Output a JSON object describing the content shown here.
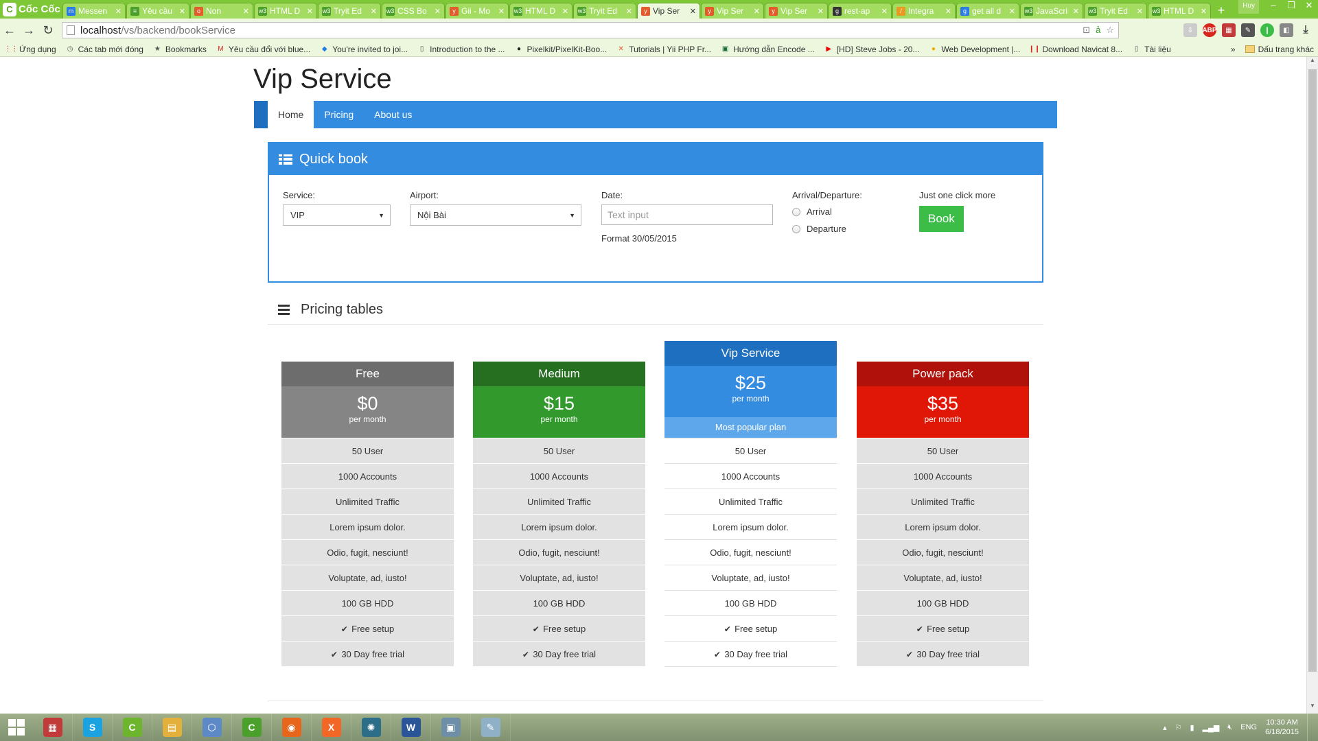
{
  "browser": {
    "brand": "Cốc Cốc",
    "tabs": [
      {
        "title": "Messen",
        "fav": "blue",
        "glyph": "m"
      },
      {
        "title": "Yêu cầu",
        "fav": "green",
        "glyph": "≡"
      },
      {
        "title": "Non",
        "fav": "red",
        "glyph": "o"
      },
      {
        "title": "HTML D",
        "fav": "green",
        "glyph": "w3"
      },
      {
        "title": "Tryit Ed",
        "fav": "green",
        "glyph": "w3"
      },
      {
        "title": "CSS Bo",
        "fav": "green",
        "glyph": "w3"
      },
      {
        "title": "Gii - Mo",
        "fav": "red",
        "glyph": "y"
      },
      {
        "title": "HTML D",
        "fav": "green",
        "glyph": "w3"
      },
      {
        "title": "Tryit Ed",
        "fav": "green",
        "glyph": "w3"
      },
      {
        "title": "Vip Ser",
        "fav": "red",
        "glyph": "y",
        "active": true
      },
      {
        "title": "Vip Ser",
        "fav": "red",
        "glyph": "y"
      },
      {
        "title": "Vip Ser",
        "fav": "red",
        "glyph": "y"
      },
      {
        "title": "rest-ap",
        "fav": "dark",
        "glyph": "g"
      },
      {
        "title": "Integra",
        "fav": "orange",
        "glyph": "/"
      },
      {
        "title": "get all d",
        "fav": "blue",
        "glyph": "g"
      },
      {
        "title": "JavaScri",
        "fav": "green",
        "glyph": "w3"
      },
      {
        "title": "Tryit Ed",
        "fav": "green",
        "glyph": "w3"
      },
      {
        "title": "HTML D",
        "fav": "green",
        "glyph": "w3"
      }
    ],
    "profile_label": "Huy",
    "url_host": "localhost",
    "url_path": "/vs/backend/bookService",
    "bookmarks": [
      {
        "label": "Ứng dụng",
        "icon": "apps-icon"
      },
      {
        "label": "Các tab mới đóng",
        "icon": "history-icon"
      },
      {
        "label": "Bookmarks",
        "icon": "star-icon"
      },
      {
        "label": "Yêu cầu đổi với blue...",
        "icon": "gmail-icon"
      },
      {
        "label": "You're invited to joi...",
        "icon": "dropbox-icon"
      },
      {
        "label": "Introduction to the ...",
        "icon": "page-icon"
      },
      {
        "label": "Pixelkit/PixelKit-Boo...",
        "icon": "github-icon"
      },
      {
        "label": "Tutorials | Yii PHP Fr...",
        "icon": "yii-icon"
      },
      {
        "label": "Hướng dẫn Encode ...",
        "icon": "site-icon"
      },
      {
        "label": "[HD] Steve Jobs - 20...",
        "icon": "youtube-icon"
      },
      {
        "label": "Web Development |...",
        "icon": "web-icon"
      },
      {
        "label": "Download Navicat 8...",
        "icon": "navicat-icon"
      },
      {
        "label": "Tài liệu",
        "icon": "page-icon"
      }
    ],
    "bookmarks_more": "»",
    "other_bookmarks": "Dấu trang khác"
  },
  "page": {
    "site_title": "Vip Service",
    "nav": [
      "Home",
      "Pricing",
      "About us"
    ],
    "quick_book": {
      "title": "Quick book",
      "service_label": "Service:",
      "service_value": "VIP",
      "airport_label": "Airport:",
      "airport_value": "Nội Bài",
      "date_label": "Date:",
      "date_placeholder": "Text input",
      "date_help": "Format 30/05/2015",
      "direction_label": "Arrival/Departure:",
      "direction_options": [
        "Arrival",
        "Departure"
      ],
      "book_hint": "Just one click more",
      "book_button": "Book"
    },
    "pricing_title": "Pricing tables",
    "plans": [
      {
        "name": "Free",
        "price": "$0",
        "period": "per month",
        "color_head": "#6d6d6d",
        "color_body": "#858585"
      },
      {
        "name": "Medium",
        "price": "$15",
        "period": "per month",
        "color_head": "#266e20",
        "color_body": "#329a2c"
      },
      {
        "name": "Vip Service",
        "price": "$25",
        "period": "per month",
        "popular": "Most popular plan",
        "color_head": "#1f6fc0",
        "color_body": "#338ce0",
        "color_popular": "#5ea7ea",
        "featured": true
      },
      {
        "name": "Power pack",
        "price": "$35",
        "period": "per month",
        "color_head": "#b0110a",
        "color_body": "#e01606"
      }
    ],
    "features": [
      "50 User",
      "1000 Accounts",
      "Unlimited Traffic",
      "Lorem ipsum dolor.",
      "Odio, fugit, nesciunt!",
      "Voluptate, ad, iusto!",
      "100 GB HDD",
      "Free setup",
      "30 Day free trial"
    ],
    "checked_features": [
      "Free setup",
      "30 Day free trial"
    ]
  },
  "taskbar": {
    "apps": [
      {
        "name": "taskbar-app-paint",
        "glyph": "▦",
        "color": "#c23b3b"
      },
      {
        "name": "taskbar-app-skype",
        "glyph": "S",
        "color": "#1aa3e0"
      },
      {
        "name": "taskbar-app-coccoc",
        "glyph": "C",
        "color": "#6cb52c"
      },
      {
        "name": "taskbar-app-explorer",
        "glyph": "▤",
        "color": "#e2b03b"
      },
      {
        "name": "taskbar-app-box",
        "glyph": "⬡",
        "color": "#5d8ac6"
      },
      {
        "name": "taskbar-app-coccoc-2",
        "glyph": "C",
        "color": "#4aa02a"
      },
      {
        "name": "taskbar-app-firefox",
        "glyph": "◉",
        "color": "#e8651c"
      },
      {
        "name": "taskbar-app-xampp",
        "glyph": "X",
        "color": "#f26725"
      },
      {
        "name": "taskbar-app-globe",
        "glyph": "✺",
        "color": "#2c6e88"
      },
      {
        "name": "taskbar-app-word",
        "glyph": "W",
        "color": "#2a5699"
      },
      {
        "name": "taskbar-app-window",
        "glyph": "▣",
        "color": "#6f8fa8"
      },
      {
        "name": "taskbar-app-notepad",
        "glyph": "✎",
        "color": "#8fb0c6"
      }
    ],
    "language": "ENG",
    "time": "10:30 AM",
    "date": "6/18/2015"
  }
}
